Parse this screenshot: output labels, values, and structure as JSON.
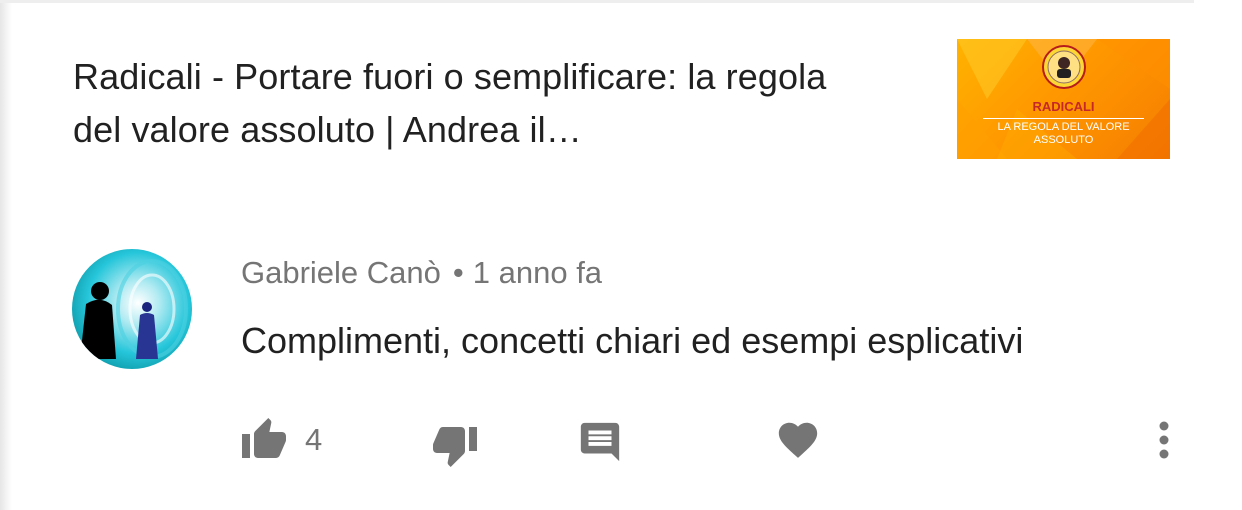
{
  "video": {
    "title": "Radicali - Portare fuori o semplificare: la regola del valore assoluto | Andrea il…",
    "thumbnail": {
      "title": "RADICALI",
      "subtitle": "LA REGOLA DEL VALORE\nASSOLUTO",
      "colors": {
        "background": "#ff9800",
        "title": "#c62828",
        "subtitle": "#ffffff"
      }
    }
  },
  "comment": {
    "author": "Gabriele Canò",
    "separator": "•",
    "time": "1 anno fa",
    "text": "Complimenti, concetti chiari ed esempi esplicativi",
    "avatar_icon": "user-avatar"
  },
  "actions": {
    "like_icon": "thumb-up-icon",
    "like_count": "4",
    "dislike_icon": "thumb-down-icon",
    "reply_icon": "comment-icon",
    "heart_icon": "heart-icon",
    "more_icon": "more-vertical-icon",
    "icon_color": "#757575"
  }
}
